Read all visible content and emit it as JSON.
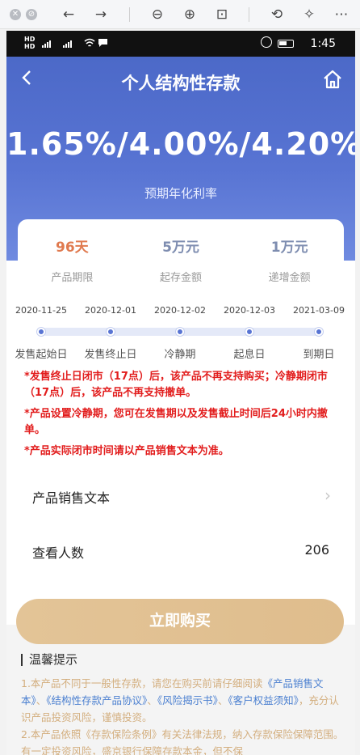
{
  "page": {
    "title": "个人结构性存款",
    "rate": "1.65%/4.00%/4.20%",
    "rate_label": "预期年化利率"
  },
  "status_bar": {
    "time": "1:45",
    "left": "HD",
    "net1": "4G",
    "net2": "4G"
  },
  "summary": [
    {
      "value": "96天",
      "label": "产品期限"
    },
    {
      "value": "5万元",
      "label": "起存金额"
    },
    {
      "value": "1万元",
      "label": "递增金额"
    }
  ],
  "timeline": [
    {
      "date": "2020-11-25",
      "label": "发售起始日"
    },
    {
      "date": "2020-12-01",
      "label": "发售终止日"
    },
    {
      "date": "2020-12-02",
      "label": "冷静期"
    },
    {
      "date": "2020-12-03",
      "label": "起息日"
    },
    {
      "date": "2021-03-09",
      "label": "到期日"
    }
  ],
  "notes": [
    "*发售终止日闭市（17点）后，该产品不再支持购买；冷静期闭市（17点）后，该产品不再支持撤单。",
    "*产品设置冷静期，您可在发售期以及发售截止时间后24小时内撤单。",
    "*产品实际闭市时间请以产品销售文本为准。"
  ],
  "rows": {
    "sales_doc": "产品销售文本",
    "viewers_label": "查看人数",
    "viewers_value": "206"
  },
  "buy_button": "立即购买",
  "tips": {
    "title": "温馨提示",
    "p1_a": "1.本产品不同于一般性存款，请您在购买前请仔细阅读",
    "p1_l1": "《产品销售文本》",
    "p1_s1": "、",
    "p1_l2": "《结构性存款产品协议》",
    "p1_s2": "、",
    "p1_l3": "《风险揭示书》",
    "p1_s3": "、",
    "p1_l4": "《客户权益须知》",
    "p1_b": "，充分认识产品投资风险，谨慎投资。",
    "p2": "2.本产品依照《存款保险条例》有关法律法规，纳入存款保险保障范围。有一定投资风险，盛京银行保障存款本金，但不保"
  },
  "colors": {
    "hero_blue": "#5874d3",
    "accent_orange": "#e07a4f",
    "warning_red": "#e21d1d",
    "gold": "#dfbd8d"
  }
}
